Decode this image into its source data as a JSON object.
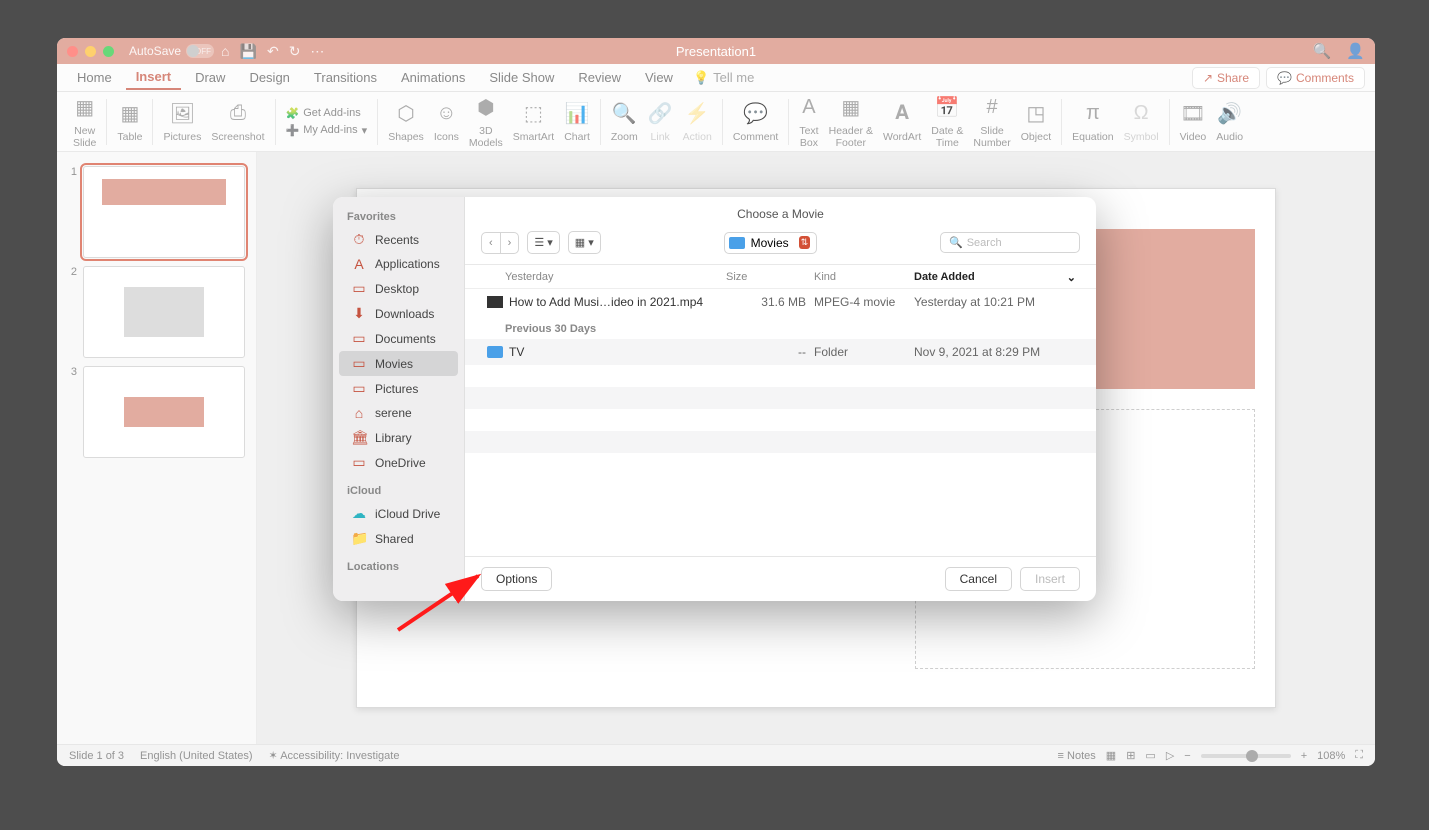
{
  "titlebar": {
    "autosave_label": "AutoSave",
    "autosave_state": "OFF",
    "title": "Presentation1"
  },
  "tabs": {
    "items": [
      "Home",
      "Insert",
      "Draw",
      "Design",
      "Transitions",
      "Animations",
      "Slide Show",
      "Review",
      "View"
    ],
    "active": "Insert",
    "tellme": "Tell me",
    "share": "Share",
    "comments": "Comments"
  },
  "ribbon": {
    "new_slide": "New\nSlide",
    "table": "Table",
    "pictures": "Pictures",
    "screenshot": "Screenshot",
    "get_addins": "Get Add-ins",
    "my_addins": "My Add-ins",
    "shapes": "Shapes",
    "icons": "Icons",
    "models": "3D\nModels",
    "smartart": "SmartArt",
    "chart": "Chart",
    "zoom": "Zoom",
    "link": "Link",
    "action": "Action",
    "comment": "Comment",
    "textbox": "Text\nBox",
    "header_footer": "Header &\nFooter",
    "wordart": "WordArt",
    "datetime": "Date &\nTime",
    "slidenum": "Slide\nNumber",
    "object": "Object",
    "equation": "Equation",
    "symbol": "Symbol",
    "video": "Video",
    "audio": "Audio"
  },
  "slides": {
    "numbers": [
      "1",
      "2",
      "3"
    ]
  },
  "dialog": {
    "title": "Choose a Movie",
    "sidebar": {
      "favorites": "Favorites",
      "items": [
        {
          "icon": "⏱",
          "label": "Recents",
          "cls": ""
        },
        {
          "icon": "A",
          "label": "Applications",
          "cls": ""
        },
        {
          "icon": "▭",
          "label": "Desktop",
          "cls": ""
        },
        {
          "icon": "⬇",
          "label": "Downloads",
          "cls": ""
        },
        {
          "icon": "▭",
          "label": "Documents",
          "cls": ""
        },
        {
          "icon": "▭",
          "label": "Movies",
          "cls": "sel"
        },
        {
          "icon": "▭",
          "label": "Pictures",
          "cls": ""
        },
        {
          "icon": "⌂",
          "label": "serene",
          "cls": ""
        },
        {
          "icon": "🏛",
          "label": "Library",
          "cls": ""
        },
        {
          "icon": "▭",
          "label": "OneDrive",
          "cls": ""
        }
      ],
      "icloud": "iCloud",
      "icloud_items": [
        {
          "icon": "☁",
          "label": "iCloud Drive"
        },
        {
          "icon": "📁",
          "label": "Shared"
        }
      ],
      "locations": "Locations"
    },
    "location": "Movies",
    "search_placeholder": "Search",
    "columns": {
      "c1": "Yesterday",
      "c2": "Size",
      "c3": "Kind",
      "c4": "Date Added"
    },
    "rows": [
      {
        "section": null,
        "icon": "▶",
        "name": "How to Add Musi…ideo in 2021.mp4",
        "size": "31.6 MB",
        "kind": "MPEG-4 movie",
        "date": "Yesterday at 10:21 PM",
        "alt": false
      },
      {
        "section": "Previous 30 Days"
      },
      {
        "section": null,
        "icon": "📁",
        "name": "TV",
        "size": "--",
        "kind": "Folder",
        "date": "Nov 9, 2021 at 8:29 PM",
        "alt": true
      }
    ],
    "buttons": {
      "options": "Options",
      "cancel": "Cancel",
      "insert": "Insert"
    }
  },
  "status": {
    "slide": "Slide 1 of 3",
    "lang": "English (United States)",
    "access": "Accessibility: Investigate",
    "notes": "Notes",
    "zoom": "108%"
  }
}
